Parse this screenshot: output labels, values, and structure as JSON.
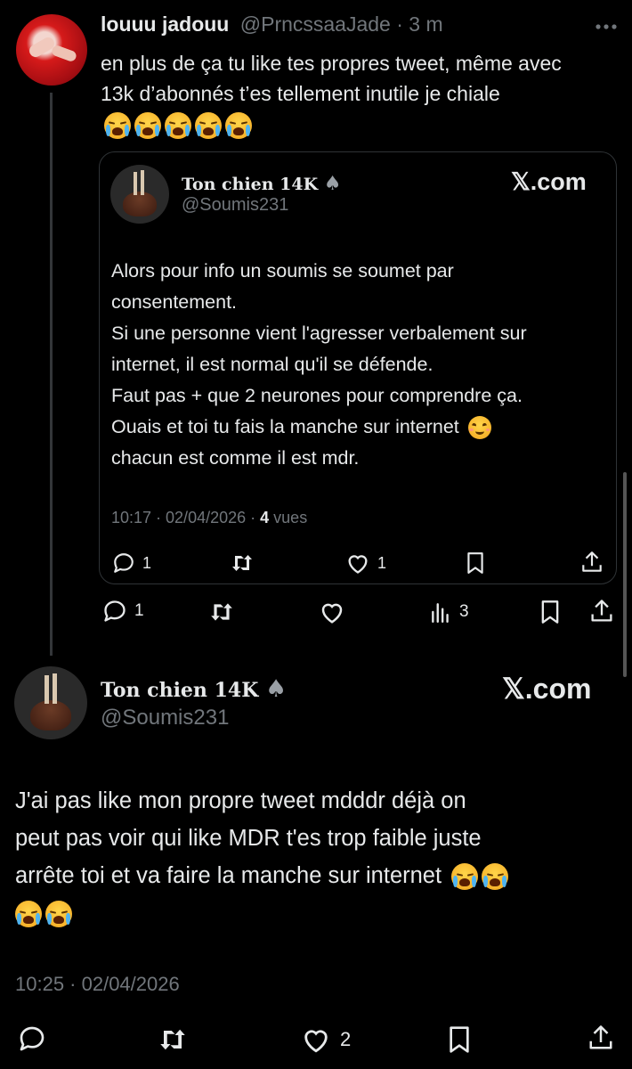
{
  "tweet1": {
    "display_name": "louuu jadouu",
    "handle": "@PrncssaaJade",
    "time_ago": "· 3 m",
    "text": "en plus de ça tu like tes propres tweet, même avec 13k d’abonnés t’es tellement inutile je chiale",
    "emoji_count": 5,
    "actions": {
      "reply_count": "1",
      "views": "3"
    }
  },
  "quote": {
    "display_name": "Ton chien 14K",
    "handle": "@Soumis231",
    "brand": "𝕏.com",
    "lines": [
      "Alors pour info un soumis se soumet par",
      "consentement.",
      "Si une personne vient l'agresser verbalement sur",
      "internet, il est normal qu'il se défende.",
      "Faut pas + que 2 neurones pour comprendre ça.",
      "Ouais et toi tu fais la manche sur internet",
      "chacun est comme il est mdr."
    ],
    "timestamp": "10:17 · 02/04/2026 ·",
    "views_count": "4",
    "views_label": "vues",
    "actions": {
      "reply_count": "1",
      "like_count": "1"
    }
  },
  "tweet2": {
    "display_name": "Ton chien 14K",
    "handle": "@Soumis231",
    "brand": "𝕏.com",
    "lines": [
      "J'ai pas like mon propre tweet mdddr déjà on",
      "peut pas voir qui like MDR t'es trop faible juste",
      "arrête toi et va faire la manche sur internet"
    ],
    "timestamp": "10:25 · 02/04/2026",
    "actions": {
      "like_count": "2"
    }
  }
}
